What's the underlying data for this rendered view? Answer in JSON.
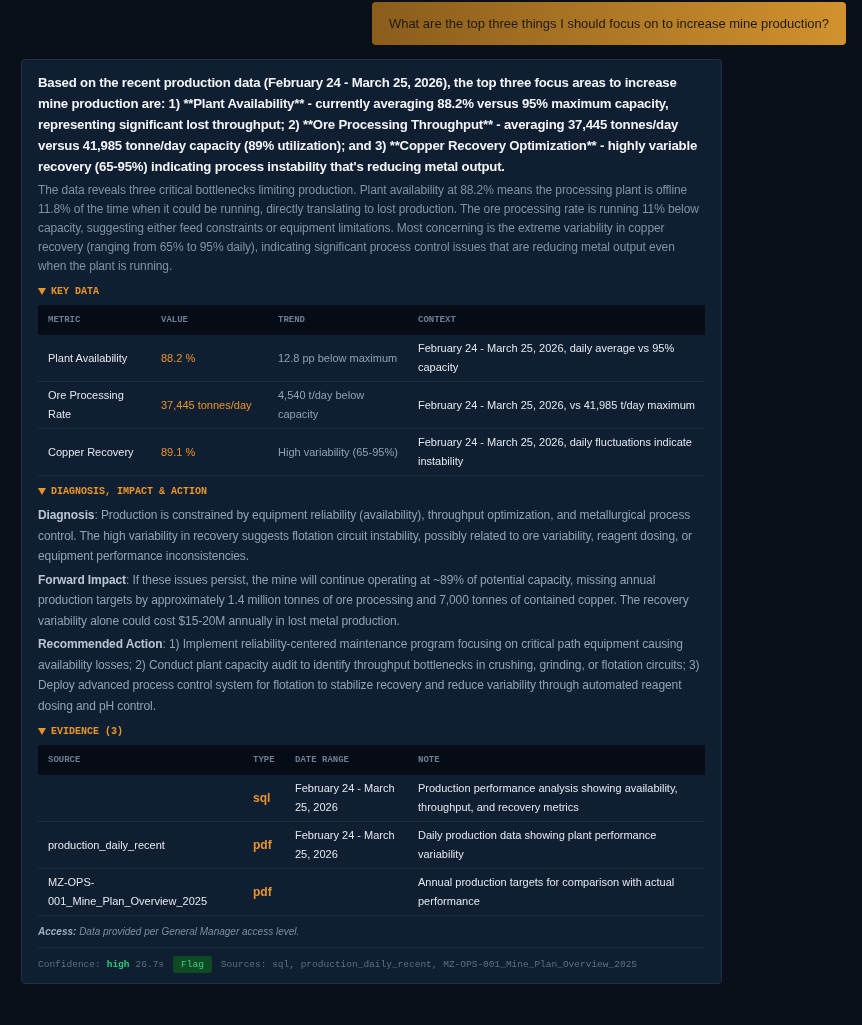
{
  "question": "What are the top three things I should focus on to increase mine production?",
  "summary": "Based on the recent production data (February 24 - March 25, 2026), the top three focus areas to increase mine production are: 1) **Plant Availability** - currently averaging 88.2% versus 95% maximum capacity, representing significant lost throughput; 2) **Ore Processing Throughput** - averaging 37,445 tonnes/day versus 41,985 tonne/day capacity (89% utilization); and 3) **Copper Recovery Optimization** - highly variable recovery (65-95%) indicating process instability that's reducing metal output.",
  "explanation": "The data reveals three critical bottlenecks limiting production. Plant availability at 88.2% means the processing plant is offline 11.8% of the time when it could be running, directly translating to lost production. The ore processing rate is running 11% below capacity, suggesting either feed constraints or equipment limitations. Most concerning is the extreme variability in copper recovery (ranging from 65% to 95% daily), indicating significant process control issues that are reducing metal output even when the plant is running.",
  "key_data": {
    "title": "KEY DATA",
    "expanded": true,
    "columns": [
      "METRIC",
      "VALUE",
      "TREND",
      "CONTEXT"
    ],
    "rows": [
      {
        "metric": "Plant Availability",
        "value": "88.2 %",
        "trend": "12.8 pp below maximum",
        "context": "February 24 - March 25, 2026, daily average vs 95% capacity"
      },
      {
        "metric": "Ore Processing Rate",
        "value": "37,445 tonnes/day",
        "trend": "4,540 t/day below capacity",
        "context": "February 24 - March 25, 2026, vs 41,985 t/day maximum"
      },
      {
        "metric": "Copper Recovery",
        "value": "89.1 %",
        "trend": "High variability (65-95%)",
        "context": "February 24 - March 25, 2026, daily fluctuations indicate instability"
      }
    ]
  },
  "diagnosis": {
    "title": "DIAGNOSIS, IMPACT & ACTION",
    "expanded": true,
    "paragraphs": [
      "**Diagnosis**: Production is constrained by equipment reliability (availability), throughput optimization, and metallurgical process control. The high variability in recovery suggests flotation circuit instability, possibly related to ore variability, reagent dosing, or equipment performance inconsistencies.",
      "**Forward Impact**: If these issues persist, the mine will continue operating at ~89% of potential capacity, missing annual production targets by approximately 1.4 million tonnes of ore processing and 7,000 tonnes of contained copper. The recovery variability alone could cost $15-20M annually in lost metal production.",
      "**Recommended Action**: 1) Implement reliability-centered maintenance program focusing on critical path equipment causing availability losses; 2) Conduct plant capacity audit to identify throughput bottlenecks in crushing, grinding, or flotation circuits; 3) Deploy advanced process control system for flotation to stabilize recovery and reduce variability through automated reagent dosing and pH control."
    ]
  },
  "evidence": {
    "title": "EVIDENCE (3)",
    "expanded": true,
    "columns": [
      "SOURCE",
      "TYPE",
      "DATE RANGE",
      "NOTE"
    ],
    "rows": [
      {
        "source": "",
        "type": "sql",
        "date_range": "February 24 - March 25, 2026",
        "note": "Production performance analysis showing availability, throughput, and recovery metrics"
      },
      {
        "source": "production_daily_recent",
        "type": "pdf",
        "date_range": "February 24 - March 25, 2026",
        "note": "Daily production data showing plant performance variability"
      },
      {
        "source": "MZ-OPS-001_Mine_Plan_Overview_2025",
        "type": "pdf",
        "date_range": "",
        "note": "Annual production targets for comparison with actual performance"
      }
    ]
  },
  "access": "**Access:** Data provided per General Manager access level.",
  "footer": {
    "confidence_label": "Confidence:",
    "confidence": "high",
    "time": "26.7s",
    "flag": "Flag",
    "sources": "Sources: sql, production_daily_recent, MZ-OPS-001_Mine_Plan_Overview_2025"
  }
}
